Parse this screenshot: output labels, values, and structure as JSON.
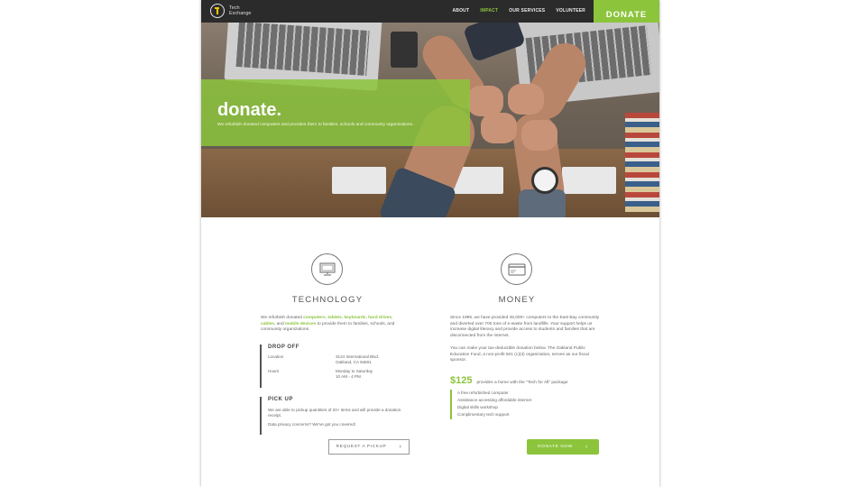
{
  "nav": {
    "logo_line1": "Tech",
    "logo_line2": "Exchange",
    "links": [
      "ABOUT",
      "IMPACT",
      "OUR SERVICES",
      "VOLUNTEER"
    ],
    "donate_label": "DONATE"
  },
  "hero": {
    "title": "donate.",
    "subtitle": "We refurbish donated computers and provides them to families, schools and community organizations."
  },
  "technology": {
    "icon": "monitor-icon",
    "title": "TECHNOLOGY",
    "intro_pre": "We refurbish donated ",
    "intro_items": [
      "computers",
      "tablets",
      "keyboards",
      "hard drives",
      "cables",
      "mobile devices"
    ],
    "intro_post": " to provide them to families, schools, and community organizations.",
    "dropoff": {
      "title": "DROP OFF",
      "location_label": "Location",
      "location_line1": "3124 International Blvd.",
      "location_line2": "Oakland, CA 94601",
      "hours_label": "Hours",
      "hours_line1": "Monday to Saturday",
      "hours_line2": "10 AM - 4 PM"
    },
    "pickup": {
      "title": "PICK UP",
      "text": "We are able to pickup quantities of 20+ items and will provide a donation receipt.",
      "privacy": "Data privacy concerns? We've got you covered!",
      "button": "REQUEST A PICKUP"
    }
  },
  "money": {
    "icon": "credit-card-icon",
    "title": "MONEY",
    "para1": "Since 1995, we have provided 45,000+ computers to the East Bay community and diverted over 700 tons of e-waste from landfills. Your support helps us increase digital literacy and provide access to students and families that are disconnected from the internet.",
    "para2": "You can make your tax-deductible donation below. The Oakland Public Education Fund, a non-profit 501 (c)(3) organization, serves as our fiscal sponsor.",
    "price": "$125",
    "price_text": "provides a home with the \"Tech for All\" package",
    "package": [
      "A free refurbished computer",
      "Assistance accessing affordable internet",
      "Digital skills workshop",
      "Complimentary tech support"
    ],
    "button": "DONATE NOW"
  },
  "colors": {
    "accent": "#8cc43c",
    "nav_bg": "#2b2b2b"
  }
}
